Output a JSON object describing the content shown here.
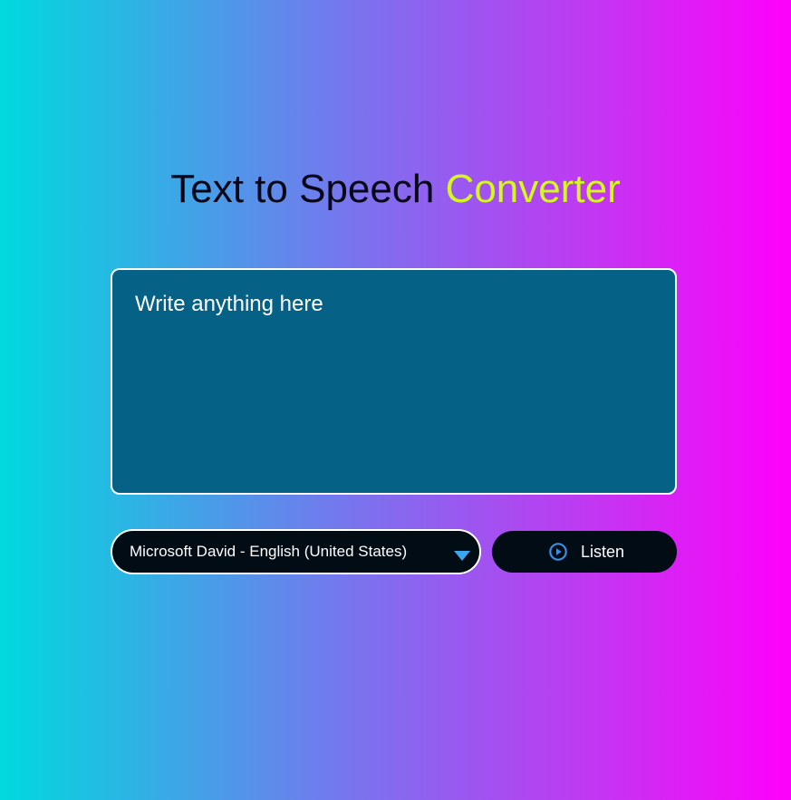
{
  "heading": {
    "main": "Text to Speech",
    "accent": "Converter"
  },
  "editor": {
    "placeholder": "Write anything here",
    "value": ""
  },
  "voice_select": {
    "selected": "Microsoft David - English (United States)"
  },
  "listen_button": {
    "label": "Listen",
    "icon": "play-circle-icon"
  },
  "colors": {
    "gradient_start": "#00d9de",
    "gradient_end": "#ff00fb",
    "accent_text": "#d4f71f",
    "textarea_bg": "#056286",
    "control_bg": "#020c14",
    "icon_blue": "#3aa6ee"
  }
}
